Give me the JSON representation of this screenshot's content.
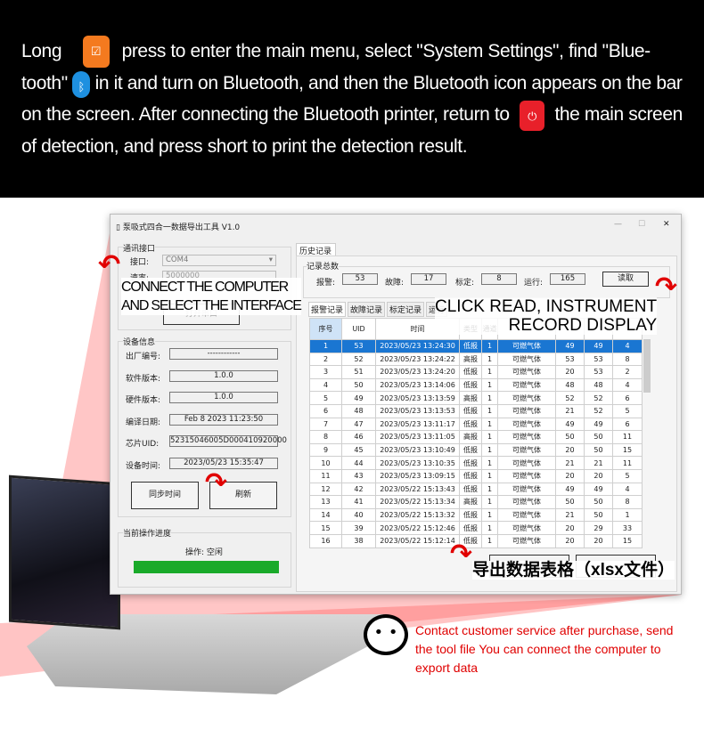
{
  "header": {
    "t1": "Long",
    "t2": "press to enter the main menu, select \"System Settings\", find \"Blue-tooth\"",
    "t3": "in it and turn on Bluetooth, and then the Bluetooth icon appears on the bar on the screen. After connecting the Bluetooth printer, return to",
    "t4": "the main screen of detection, and press short to print the detection result.",
    "icons": [
      "menu-button-icon",
      "bluetooth-icon",
      "power-button-icon"
    ],
    "colors": {
      "menu": "#f47a1f",
      "bluetooth": "#1e90e0",
      "power": "#e8202a"
    }
  },
  "window": {
    "title": "泵吸式四合一数据导出工具 V1.0",
    "minimize": "—",
    "maximize": "☐",
    "close": "✕"
  },
  "comm": {
    "group": "通讯接口",
    "port_label": "接口:",
    "port_value": "COM4",
    "rate_label": "速率:",
    "rate_value": "5000000",
    "open_button": "打开串口"
  },
  "device": {
    "group": "设备信息",
    "rows": [
      {
        "label": "出厂编号:",
        "value": "------------"
      },
      {
        "label": "软件版本:",
        "value": "1.0.0"
      },
      {
        "label": "硬件版本:",
        "value": "1.0.0"
      },
      {
        "label": "编译日期:",
        "value": "Feb  8 2023 11:23:50"
      },
      {
        "label": "芯片UID:",
        "value": "52315046005D000410920000"
      },
      {
        "label": "设备时间:",
        "value": "2023/05/23 15:35:47"
      }
    ],
    "sync_button": "同步时间",
    "refresh_button": "刷新"
  },
  "progress": {
    "group": "当前操作进度",
    "status": "操作: 空闲",
    "percent": 100,
    "color": "#1aaa2a"
  },
  "history": {
    "tab": "历史记录",
    "totals_group": "记录总数",
    "alarm_label": "报警:",
    "alarm": "53",
    "fault_label": "故障:",
    "fault": "17",
    "calib_label": "标定:",
    "calib": "8",
    "run_label": "运行:",
    "run": "165",
    "read_button": "读取",
    "subtabs": [
      "报警记录",
      "故障记录",
      "标定记录",
      "运行"
    ],
    "columns": [
      "序号",
      "UID",
      "时间",
      "类型",
      "通道",
      "",
      "",
      "",
      ""
    ],
    "rows": [
      [
        "1",
        "53",
        "2023/05/23 13:24:30",
        "低报",
        "1",
        "可燃气体",
        "49",
        "49",
        "4"
      ],
      [
        "2",
        "52",
        "2023/05/23 13:24:22",
        "高报",
        "1",
        "可燃气体",
        "53",
        "53",
        "8"
      ],
      [
        "3",
        "51",
        "2023/05/23 13:24:20",
        "低报",
        "1",
        "可燃气体",
        "20",
        "53",
        "2"
      ],
      [
        "4",
        "50",
        "2023/05/23 13:14:06",
        "低报",
        "1",
        "可燃气体",
        "48",
        "48",
        "4"
      ],
      [
        "5",
        "49",
        "2023/05/23 13:13:59",
        "高报",
        "1",
        "可燃气体",
        "52",
        "52",
        "6"
      ],
      [
        "6",
        "48",
        "2023/05/23 13:13:53",
        "低报",
        "1",
        "可燃气体",
        "21",
        "52",
        "5"
      ],
      [
        "7",
        "47",
        "2023/05/23 13:11:17",
        "低报",
        "1",
        "可燃气体",
        "49",
        "49",
        "6"
      ],
      [
        "8",
        "46",
        "2023/05/23 13:11:05",
        "高报",
        "1",
        "可燃气体",
        "50",
        "50",
        "11"
      ],
      [
        "9",
        "45",
        "2023/05/23 13:10:49",
        "低报",
        "1",
        "可燃气体",
        "20",
        "50",
        "15"
      ],
      [
        "10",
        "44",
        "2023/05/23 13:10:35",
        "低报",
        "1",
        "可燃气体",
        "21",
        "21",
        "11"
      ],
      [
        "11",
        "43",
        "2023/05/23 13:09:15",
        "低报",
        "1",
        "可燃气体",
        "20",
        "20",
        "5"
      ],
      [
        "12",
        "42",
        "2023/05/22 15:13:43",
        "低报",
        "1",
        "可燃气体",
        "49",
        "49",
        "4"
      ],
      [
        "13",
        "41",
        "2023/05/22 15:13:34",
        "高报",
        "1",
        "可燃气体",
        "50",
        "50",
        "8"
      ],
      [
        "14",
        "40",
        "2023/05/22 15:13:32",
        "低报",
        "1",
        "可燃气体",
        "21",
        "50",
        "1"
      ],
      [
        "15",
        "39",
        "2023/05/22 15:12:46",
        "低报",
        "1",
        "可燃气体",
        "20",
        "29",
        "33"
      ],
      [
        "16",
        "38",
        "2023/05/22 15:12:14",
        "低报",
        "1",
        "可燃气体",
        "20",
        "20",
        "15"
      ]
    ]
  },
  "captions": {
    "connect": "CONNECT THE COMPUTER\nAND SELECT THE INTERFACE",
    "read": "CLICK READ, INSTRUMENT\nRECORD DISPLAY",
    "export": "导出数据表格（xlsx文件）"
  },
  "footer": {
    "note": "Contact customer service after purchase, send the tool file You can connect the computer to export data",
    "color": "#e00000"
  }
}
